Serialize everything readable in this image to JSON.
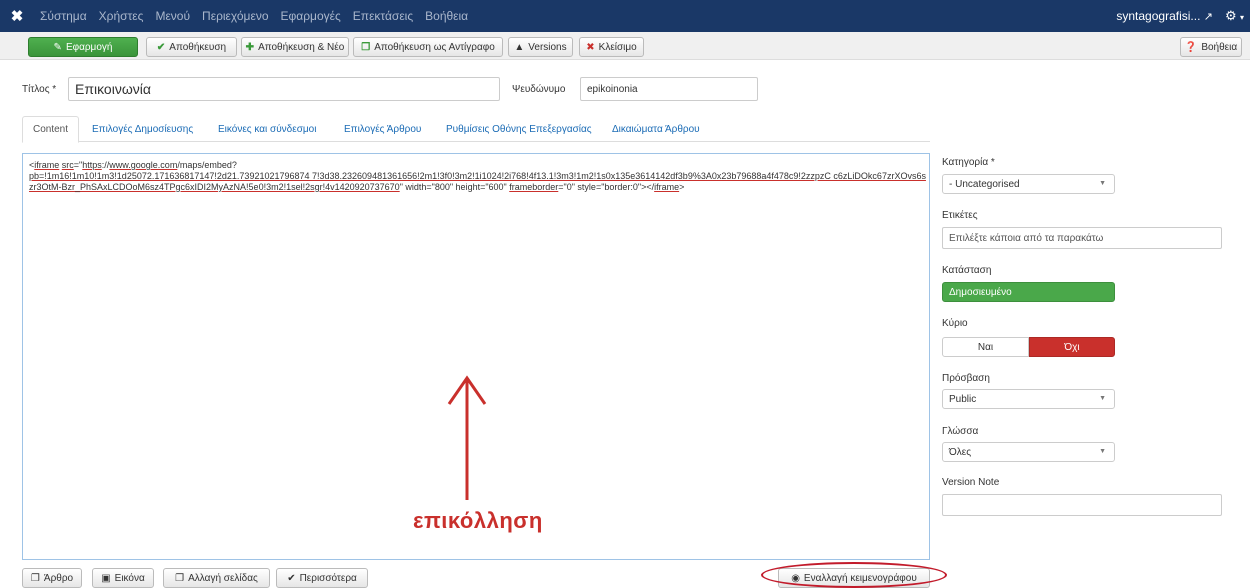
{
  "navbar": {
    "logo_glyph": "✖",
    "menu": [
      "Σύστημα",
      "Χρήστες",
      "Μενού",
      "Περιεχόμενο",
      "Εφαρμογές",
      "Επεκτάσεις",
      "Βοήθεια"
    ],
    "site_name": "syntagografisi...",
    "site_icon": "external-link-icon",
    "settings_icon": "gear-icon"
  },
  "toolbar": {
    "apply": "Εφαρμογή",
    "save": "Αποθήκευση",
    "save_new": "Αποθήκευση & Νέο",
    "save_copy": "Αποθήκευση ως Αντίγραφο",
    "versions": "Versions",
    "close": "Κλείσιμο",
    "help": "Βοήθεια"
  },
  "form": {
    "title_label": "Τίτλος *",
    "title_value": "Επικοινωνία",
    "alias_label": "Ψευδώνυμο",
    "alias_value": "epikoinonia"
  },
  "tabs": [
    "Content",
    "Επιλογές Δημοσίευσης",
    "Εικόνες και σύνδεσμοι",
    "Επιλογές Άρθρου",
    "Ρυθμίσεις Οθόνης Επεξεργασίας",
    "Δικαιώματα Άρθρου"
  ],
  "editor": {
    "c1": "<",
    "c2": "iframe",
    "c3": " ",
    "c4": "src",
    "c5": "=\"",
    "c6": "https",
    "c7": "://",
    "c8": "www.google.com",
    "c9": "/maps/embed?",
    "c10": "pb=!1m16!1m10!1m3!1d25072.171636817147!2d21.73921021796874 7!3d38.232609481361656!2m1!3f0!3m2!1i1024!2i768!4f13.1!3m3!1m2!1s0x135e3614142df3b9%3A0x23b79688a4f478c9!2zzpzC c6zLiDOkc67zrXOvs6szr3OtM-Bzr_PhSAxLCDOoM6sz4TPgc6xIDI2MyAzNA!5e0!3m2!1sel!2sgr!4v1420920737670",
    "c11": "\" width=\"800\" height=\"600\" ",
    "c12": "frameborder",
    "c13": "=\"0\" style=\"border:0\"></",
    "c14": "iframe",
    "c15": ">",
    "annotation": "επικόλληση",
    "annotation_color": "#c9302c"
  },
  "bottom_buttons": {
    "article": "Άρθρο",
    "image": "Εικόνα",
    "pagebreak": "Αλλαγή σελίδας",
    "more": "Περισσότερα",
    "toggle_editor": "Εναλλαγή κειμενογράφου"
  },
  "sidebar": {
    "category_label": "Κατηγορία *",
    "category_value": "- Uncategorised",
    "tags_label": "Ετικέτες",
    "tags_placeholder": "Επιλέξτε κάποια από τα παρακάτω",
    "state_label": "Κατάσταση",
    "state_value": "Δημοσιευμένο",
    "featured_label": "Κύριο",
    "featured_yes": "Ναι",
    "featured_no": "Όχι",
    "access_label": "Πρόσβαση",
    "access_value": "Public",
    "language_label": "Γλώσσα",
    "language_value": "Όλες",
    "version_note_label": "Version Note",
    "version_note_value": ""
  },
  "colors": {
    "navbar": "#1a3867",
    "apply_green": "#4aa84a",
    "danger_red": "#c9302c",
    "link_blue": "#1a6bb5"
  }
}
